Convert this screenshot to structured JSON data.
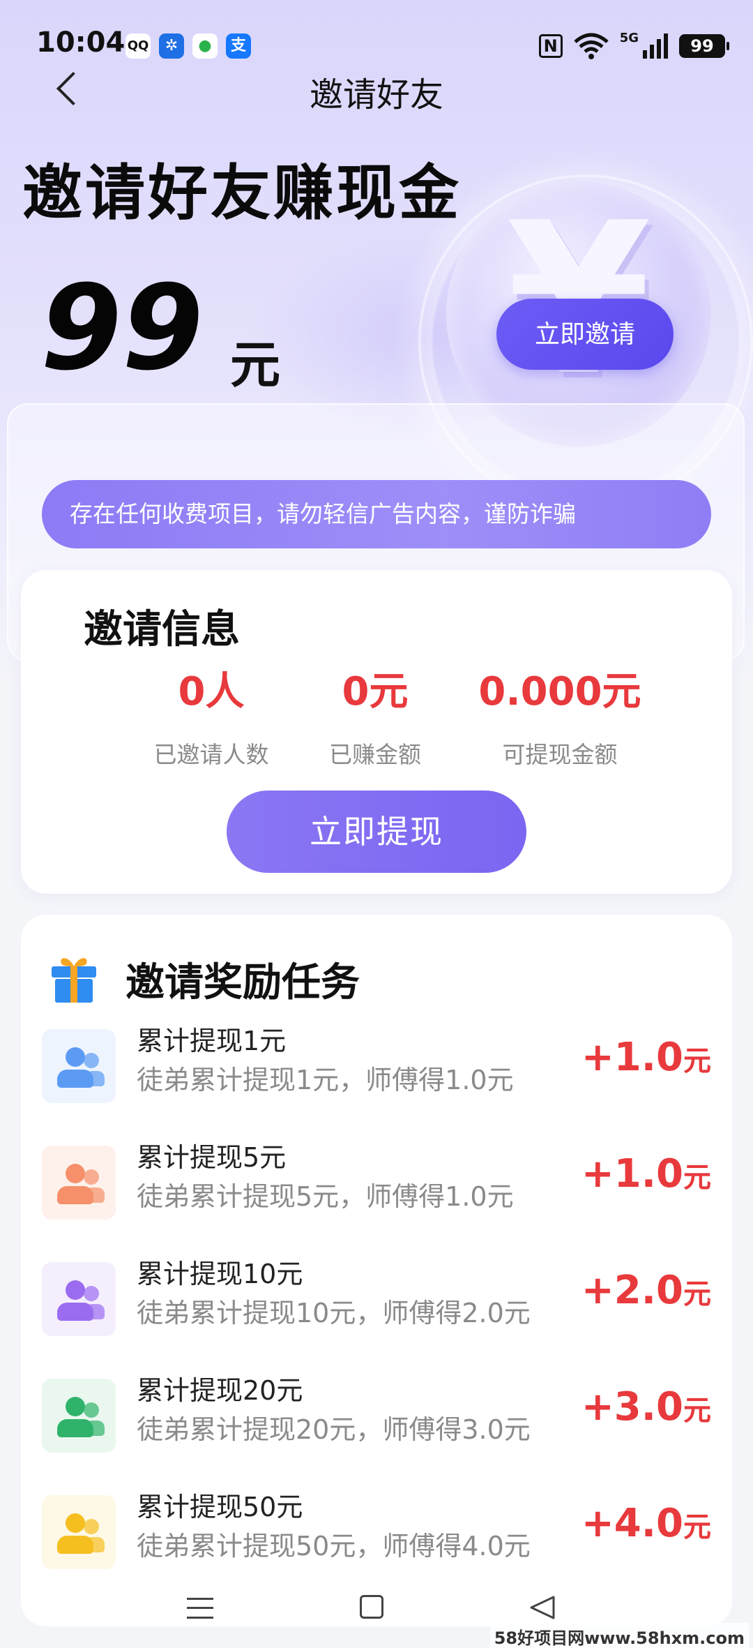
{
  "status_bar": {
    "time": "10:04",
    "apps": [
      "QQ",
      "✲",
      "●",
      "支"
    ],
    "nfc": "N",
    "network": "5G",
    "battery": "99"
  },
  "nav": {
    "title": "邀请好友"
  },
  "hero": {
    "title": "邀请好友赚现金",
    "amount": "99",
    "unit": "元",
    "invite_button": "立即邀请"
  },
  "notice": {
    "text": "存在任何收费项目，请勿轻信广告内容，谨防诈骗"
  },
  "info": {
    "title": "邀请信息",
    "stats": [
      {
        "value": "0人",
        "label": "已邀请人数"
      },
      {
        "value": "0元",
        "label": "已赚金额"
      },
      {
        "value": "0.000元",
        "label": "可提现金额"
      }
    ],
    "withdraw_button": "立即提现"
  },
  "tasks": {
    "title": "邀请奖励任务",
    "items": [
      {
        "name": "累计提现1元",
        "desc": "徒弟累计提现1元，师傅得1.0元",
        "reward": "+1.0",
        "unit": "元",
        "color": "#5b9bf4",
        "bg": "#eef4fe"
      },
      {
        "name": "累计提现5元",
        "desc": "徒弟累计提现5元，师傅得1.0元",
        "reward": "+1.0",
        "unit": "元",
        "color": "#f5906a",
        "bg": "#fef1ec"
      },
      {
        "name": "累计提现10元",
        "desc": "徒弟累计提现10元，师傅得2.0元",
        "reward": "+2.0",
        "unit": "元",
        "color": "#9b6cf0",
        "bg": "#f4eefd"
      },
      {
        "name": "累计提现20元",
        "desc": "徒弟累计提现20元，师傅得3.0元",
        "reward": "+3.0",
        "unit": "元",
        "color": "#2fb36b",
        "bg": "#eaf7ef"
      },
      {
        "name": "累计提现50元",
        "desc": "徒弟累计提现50元，师傅得4.0元",
        "reward": "+4.0",
        "unit": "元",
        "color": "#f5bf1f",
        "bg": "#fef8e6"
      }
    ]
  },
  "watermark": "58好项目网www.58hxm.com"
}
